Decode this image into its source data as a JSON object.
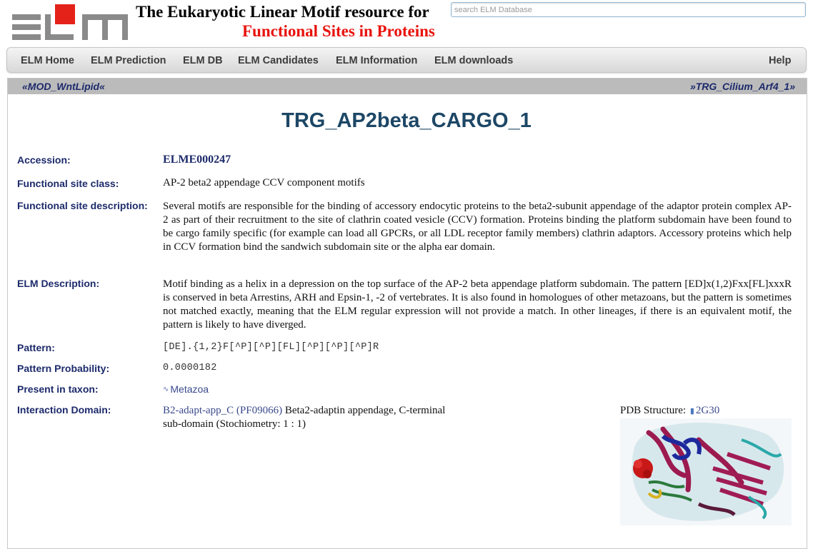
{
  "header": {
    "logo_text": "ELM",
    "title_line1": "The Eukaryotic Linear Motif resource for",
    "title_line2": "Functional Sites in Proteins",
    "search_placeholder": "search ELM Database"
  },
  "nav": {
    "items": [
      "ELM Home",
      "ELM Prediction",
      "ELM DB",
      "ELM Candidates",
      "ELM Information",
      "ELM downloads"
    ],
    "help": "Help"
  },
  "breadcrumb": {
    "prev": "«MOD_WntLipid«",
    "next": "»TRG_Cilium_Arf4_1»"
  },
  "page_title": "TRG_AP2beta_CARGO_1",
  "fields": {
    "accession_label": "Accession:",
    "accession": "ELME000247",
    "fsc_label": "Functional site class:",
    "fsc": "AP-2 beta2 appendage CCV component motifs",
    "fsd_label": "Functional site description:",
    "fsd": "Several motifs are responsible for the binding of accessory endocytic proteins to the beta2-subunit appendage of the adaptor protein complex AP-2 as part of their recruitment to the site of clathrin coated vesicle (CCV) formation. Proteins binding the platform subdomain have been found to be cargo family specific (for example can load all GPCRs, or all LDL receptor family members) clathrin adaptors. Accessory proteins which help in CCV formation bind the sandwich subdomain site or the alpha ear domain.",
    "elmdesc_label": "ELM Description:",
    "elmdesc": "Motif binding as a helix in a depression on the top surface of the AP-2 beta appendage platform subdomain. The pattern [ED]x(1,2)Fxx[FL]xxxR is conserved in beta Arrestins, ARH and Epsin-1, -2 of vertebrates. It is also found in homologues of other metazoans, but the pattern is sometimes not matched exactly, meaning that the ELM regular expression will not provide a match. In other lineages, if there is an equivalent motif, the pattern is likely to have diverged.",
    "pattern_label": "Pattern:",
    "pattern": "[DE].{1,2}F[^P][^P][FL][^P][^P][^P]R",
    "prob_label": "Pattern Probability:",
    "prob": "0.0000182",
    "taxon_label": "Present in taxon:",
    "taxon": "Metazoa",
    "domain_label": "Interaction Domain:",
    "domain_link": "B2-adapt-app_C (PF09066)",
    "domain_text1": " Beta2-adaptin appendage, C-terminal",
    "domain_text2": "sub-domain (Stochiometry: 1 : 1)",
    "pdb_label": "PDB Structure:",
    "pdb_id": "2G30"
  }
}
